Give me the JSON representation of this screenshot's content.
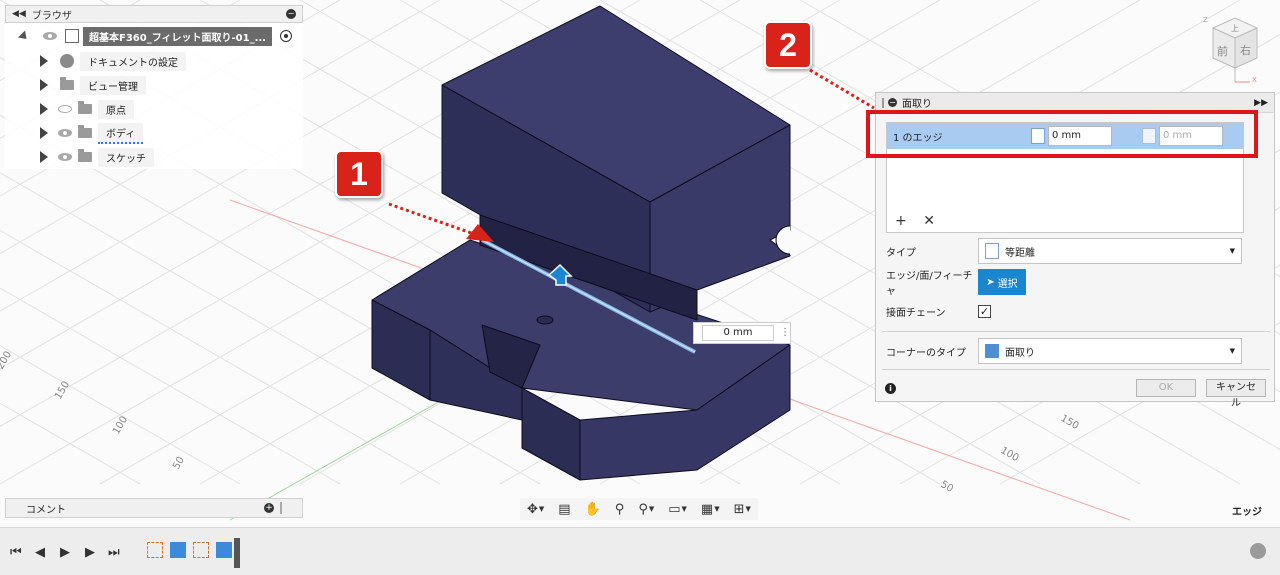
{
  "browser": {
    "title": "ブラウザ",
    "root": "超基本F360_フィレット面取り-01_...",
    "items": [
      {
        "label": "ドキュメントの設定",
        "icon": "gear-icon"
      },
      {
        "label": "ビュー管理",
        "icon": "folder-icon"
      },
      {
        "label": "原点",
        "icon": "folder-icon"
      },
      {
        "label": "ボディ",
        "icon": "folder-icon"
      },
      {
        "label": "スケッチ",
        "icon": "folder-icon"
      }
    ]
  },
  "comment": {
    "label": "コメント"
  },
  "viewport": {
    "dimension_value": "0 mm",
    "grid_labels_left": [
      "200",
      "150",
      "100",
      "50"
    ],
    "grid_labels_right": [
      "150",
      "100",
      "50"
    ],
    "status_label": "エッジ",
    "viewcube": {
      "top": "上",
      "front": "前",
      "right": "右",
      "axis_z": "Z",
      "axis_x": "X"
    }
  },
  "callouts": [
    "1",
    "2"
  ],
  "dialog": {
    "title": "面取り",
    "edge_row": {
      "label": "1 のエッジ",
      "distance1": "0 mm",
      "distance2": "0 mm"
    },
    "rows": {
      "type_label": "タイプ",
      "type_value": "等距離",
      "edge_label": "エッジ/面/フィーチャ",
      "select_button": "選択",
      "tangent_label": "接面チェーン",
      "tangent_checked": "✓",
      "corner_label": "コーナーのタイプ",
      "corner_value": "面取り"
    },
    "ok": "OK",
    "cancel": "キャンセル"
  },
  "colors": {
    "body_fill": "#35365f",
    "highlight_red": "#e0141a",
    "selection_blue": "#a9cbf2",
    "select_button_blue": "#1a86d0"
  }
}
